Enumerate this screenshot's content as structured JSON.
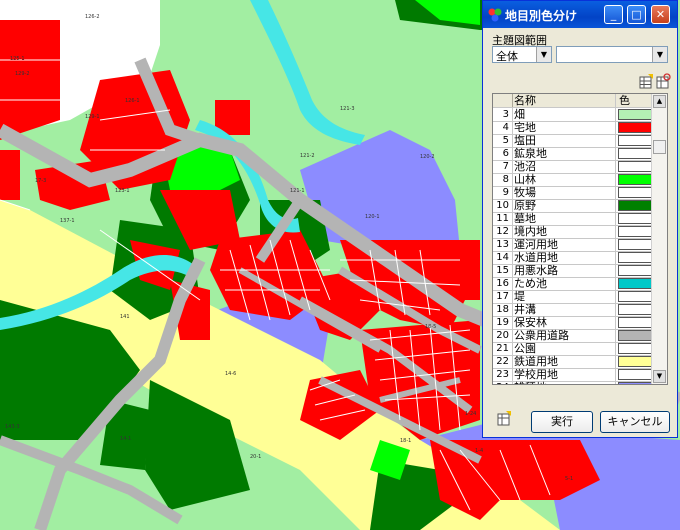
{
  "dialog": {
    "title": "地目別色分け",
    "range_label": "主題図範囲",
    "combo_scope": {
      "value": "全体"
    },
    "combo_target": {
      "value": ""
    },
    "columns": {
      "name": "名称",
      "color": "色"
    },
    "rows": [
      {
        "no": "3",
        "name": "畑",
        "color": "#b4f0b4"
      },
      {
        "no": "4",
        "name": "宅地",
        "color": "#ff0000"
      },
      {
        "no": "5",
        "name": "塩田",
        "color": "#ffffff"
      },
      {
        "no": "6",
        "name": "鉱泉地",
        "color": "#ffffff"
      },
      {
        "no": "7",
        "name": "池沼",
        "color": "#ffffff"
      },
      {
        "no": "8",
        "name": "山林",
        "color": "#00ff00"
      },
      {
        "no": "9",
        "name": "牧場",
        "color": "#ffffff"
      },
      {
        "no": "10",
        "name": "原野",
        "color": "#008000"
      },
      {
        "no": "11",
        "name": "墓地",
        "color": "#ffffff"
      },
      {
        "no": "12",
        "name": "境内地",
        "color": "#ffffff"
      },
      {
        "no": "13",
        "name": "運河用地",
        "color": "#ffffff"
      },
      {
        "no": "14",
        "name": "水道用地",
        "color": "#ffffff"
      },
      {
        "no": "15",
        "name": "用悪水路",
        "color": "#ffffff"
      },
      {
        "no": "16",
        "name": "ため池",
        "color": "#00c8c8"
      },
      {
        "no": "17",
        "name": "堤",
        "color": "#ffffff"
      },
      {
        "no": "18",
        "name": "井溝",
        "color": "#ffffff"
      },
      {
        "no": "19",
        "name": "保安林",
        "color": "#ffffff"
      },
      {
        "no": "20",
        "name": "公衆用道路",
        "color": "#b4b4b4"
      },
      {
        "no": "21",
        "name": "公園",
        "color": "#ffffff"
      },
      {
        "no": "22",
        "name": "鉄道用地",
        "color": "#ffff96"
      },
      {
        "no": "23",
        "name": "学校用地",
        "color": "#ffffff"
      },
      {
        "no": "24",
        "name": "雑種地",
        "color": "#8c8cff"
      }
    ],
    "buttons": {
      "run": "実行",
      "cancel": "キャンセル"
    },
    "icons": {
      "app": "palette-icon",
      "tool1": "table-edit-icon",
      "tool2": "table-refresh-icon",
      "tool3": "table-icon"
    }
  },
  "map": {
    "colors": {
      "field": "#a2eea2",
      "residential": "#ff0000",
      "forest": "#00ff00",
      "wilderness": "#007a00",
      "water": "#46e6e6",
      "road": "#b4b4b4",
      "railway": "#ffff96",
      "misc": "#8c8cff"
    },
    "labels": [
      "126-2",
      "129-1",
      "129-2",
      "125-1",
      "121-3",
      "121-2",
      "121-1",
      "120-1",
      "120-2",
      "137-1",
      "141",
      "14-6",
      "143-3",
      "14-1",
      "1-24",
      "1-4",
      "5-1",
      "18-5",
      "18-1",
      "20-1",
      "17-3",
      "123-1",
      "126-1"
    ]
  }
}
